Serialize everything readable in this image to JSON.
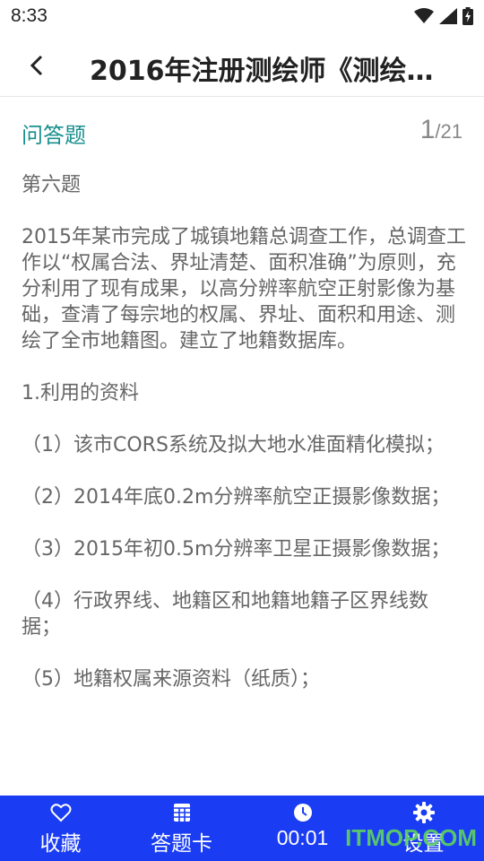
{
  "status_bar": {
    "time": "8:33",
    "icons": [
      "wifi-icon",
      "signal-icon",
      "battery-icon"
    ]
  },
  "app_bar": {
    "title": "2016年注册测绘师《测绘…",
    "back_icon": "chevron-left-icon"
  },
  "question": {
    "type": "问答题",
    "current": "1",
    "total": "/21",
    "paragraphs": [
      "第六题",
      "2015年某市完成了城镇地籍总调查工作，总调查工作以“权属合法、界址清楚、面积准确”为原则，充分利用了现有成果，以高分辨率航空正射影像为基础，查清了每宗地的权属、界址、面积和用途、测绘了全市地籍图。建立了地籍数据库。",
      "1.利用的资料",
      "（1）该市CORS系统及拟大地水准面精化模拟；",
      "（2）2014年底0.2m分辨率航空正摄影像数据；",
      "（3）2015年初0.5m分辨率卫星正摄影像数据；",
      "（4）行政界线、地籍区和地籍地籍子区界线数据；",
      "（5）地籍权属来源资料（纸质）；"
    ]
  },
  "bottom_bar": {
    "tabs": [
      {
        "label": "收藏",
        "icon": "heart-icon"
      },
      {
        "label": "答题卡",
        "icon": "grid-card-icon"
      },
      {
        "label": "00:01",
        "icon": "clock-icon"
      },
      {
        "label": "设置",
        "icon": "gear-icon"
      }
    ],
    "watermark": "ITMOP.COM"
  },
  "colors": {
    "accent_teal": "#1a8f8f",
    "bottom_bar": "#1a3cf3",
    "watermark": "#5fd35f"
  }
}
